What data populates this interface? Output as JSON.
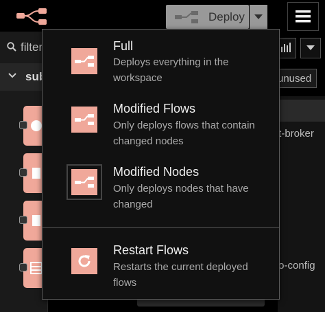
{
  "header": {
    "deploy_label": "Deploy"
  },
  "sidebar": {
    "filter_text": "filter",
    "category_label": "sub"
  },
  "workspace": {
    "unused_label": "unused",
    "node_label_1": "tt-broker",
    "node_label_2": "to-config"
  },
  "deploy_menu": {
    "items": [
      {
        "title": "Full",
        "description": "Deploys everything in the workspace",
        "icon": "deploy-full-icon"
      },
      {
        "title": "Modified Flows",
        "description": "Only deploys flows that contain changed nodes",
        "icon": "deploy-flows-icon"
      },
      {
        "title": "Modified Nodes",
        "description": "Only deploys nodes that have changed",
        "icon": "deploy-nodes-icon"
      },
      {
        "title": "Restart Flows",
        "description": "Restarts the current deployed flows",
        "icon": "restart-icon"
      }
    ]
  },
  "colors": {
    "accent": "#f0a89a",
    "deploy_button": "#999999",
    "menu_background": "#111111"
  }
}
